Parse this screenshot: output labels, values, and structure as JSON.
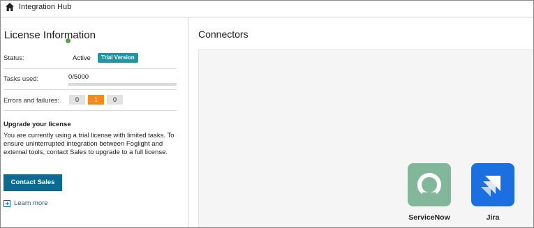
{
  "header": {
    "title": "Integration Hub",
    "home_icon": "home-icon"
  },
  "license": {
    "title": "License Information",
    "status_label": "Status:",
    "status_value": "Active",
    "status_color": "#5aa33c",
    "badge": "Trial Version",
    "tasks_label": "Tasks used:",
    "tasks_value": "0/5000",
    "tasks_progress_fraction": 0,
    "errors_label": "Errors and failures:",
    "errors": [
      "0",
      "1",
      "0"
    ],
    "upgrade_title": "Upgrade your license",
    "upgrade_text": "You are currently using a trial license with limited tasks. To ensure uninterrupted integration between Foglight and external tools, contact Sales to upgrade to a full license.",
    "contact_button": "Contact Sales",
    "learn_more": "Learn more"
  },
  "connectors": {
    "title": "Connectors",
    "items": [
      {
        "name": "ServiceNow",
        "icon": "servicenow-icon",
        "color": "#83b79b"
      },
      {
        "name": "Jira",
        "icon": "jira-icon",
        "color": "#1b6fe0"
      }
    ]
  },
  "colors": {
    "accent": "#1e96a5",
    "button": "#0b6a8f",
    "error_highlight": "#f28a1e"
  }
}
